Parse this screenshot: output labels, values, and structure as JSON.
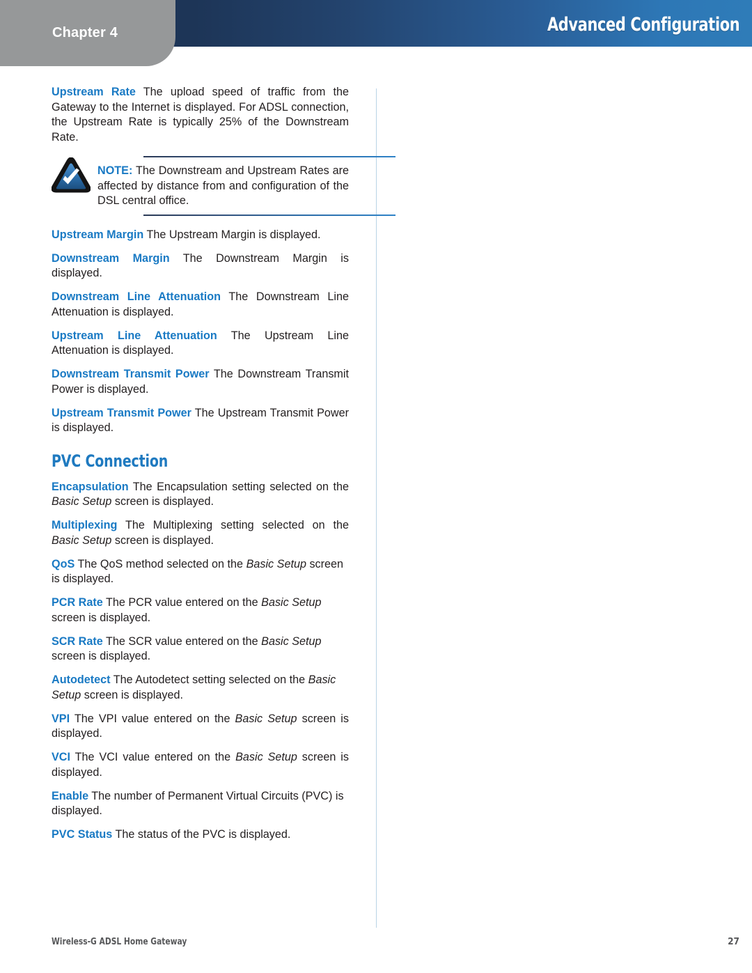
{
  "header": {
    "chapter_label": "Chapter 4",
    "title": "Advanced Configuration",
    "tab_color": "#969899",
    "band_color_left": "#1d3557",
    "band_color_right": "#2f7cb8"
  },
  "colors": {
    "term_blue": "#1a7ac4",
    "heading_blue": "#1f7ac0",
    "body_text": "#231f20",
    "divider_blue": "#b9d3e6",
    "footer_gray": "#58595b"
  },
  "content": {
    "upstream_rate": {
      "term": "Upstream Rate",
      "body": " The upload speed of traffic from the Gateway to the Internet is displayed. For ADSL connection, the Upstream Rate is typically 25% of the Downstream Rate."
    },
    "note": {
      "icon": "note-check-triangle-icon",
      "label": "NOTE:",
      "body": " The Downstream and Upstream Rates are affected by distance from and configuration of the DSL central office."
    },
    "upstream_margin": {
      "term": "Upstream Margin",
      "body": "  The Upstream Margin is displayed."
    },
    "downstream_margin": {
      "term": "Downstream Margin",
      "body": " The Downstream Margin is displayed."
    },
    "downstream_line_attenuation": {
      "term": "Downstream Line Attenuation",
      "body": " The Downstream Line Attenuation is displayed."
    },
    "upstream_line_attenuation": {
      "term": "Upstream Line Attenuation",
      "body": " The Upstream Line Attenuation is displayed."
    },
    "downstream_transmit_power": {
      "term": "Downstream Transmit Power",
      "body": "  The Downstream Transmit Power is displayed."
    },
    "upstream_transmit_power": {
      "term": "Upstream Transmit Power",
      "body": " The Upstream Transmit Power is displayed."
    },
    "pvc_connection_heading": "PVC Connection",
    "encapsulation": {
      "term": "Encapsulation",
      "body_1": " The Encapsulation setting selected on the ",
      "italic": "Basic Setup",
      "body_2": " screen is displayed."
    },
    "multiplexing": {
      "term": "Multiplexing",
      "body_1": " The Multiplexing setting selected on the ",
      "italic": "Basic Setup",
      "body_2": " screen is displayed."
    },
    "qos": {
      "term": "QoS",
      "body_1": "  The QoS method selected on the ",
      "italic": "Basic Setup",
      "body_2": " screen is displayed."
    },
    "pcr_rate": {
      "term": "PCR Rate",
      "body_1": "  The PCR value entered on the ",
      "italic": "Basic Setup",
      "body_2": " screen is displayed."
    },
    "scr_rate": {
      "term": "SCR Rate",
      "body_1": "  The SCR value entered on the ",
      "italic": "Basic Setup",
      "body_2": " screen is displayed."
    },
    "autodetect": {
      "term": "Autodetect",
      "body_1": "  The Autodetect setting selected on the ",
      "italic": "Basic Setup",
      "body_2": " screen is displayed."
    },
    "vpi": {
      "term": "VPI",
      "body_1": " The VPI value entered on the ",
      "italic": "Basic Setup",
      "body_2": " screen is displayed."
    },
    "vci": {
      "term": "VCI",
      "body_1": " The VCI value entered on the ",
      "italic": "Basic Setup",
      "body_2": " screen is displayed."
    },
    "enable": {
      "term": "Enable",
      "body": "  The number of Permanent Virtual Circuits (PVC) is displayed."
    },
    "pvc_status": {
      "term": "PVC Status",
      "body": "  The status of the PVC is displayed."
    }
  },
  "footer": {
    "product": "Wireless-G ADSL Home Gateway",
    "page_number": "27"
  }
}
